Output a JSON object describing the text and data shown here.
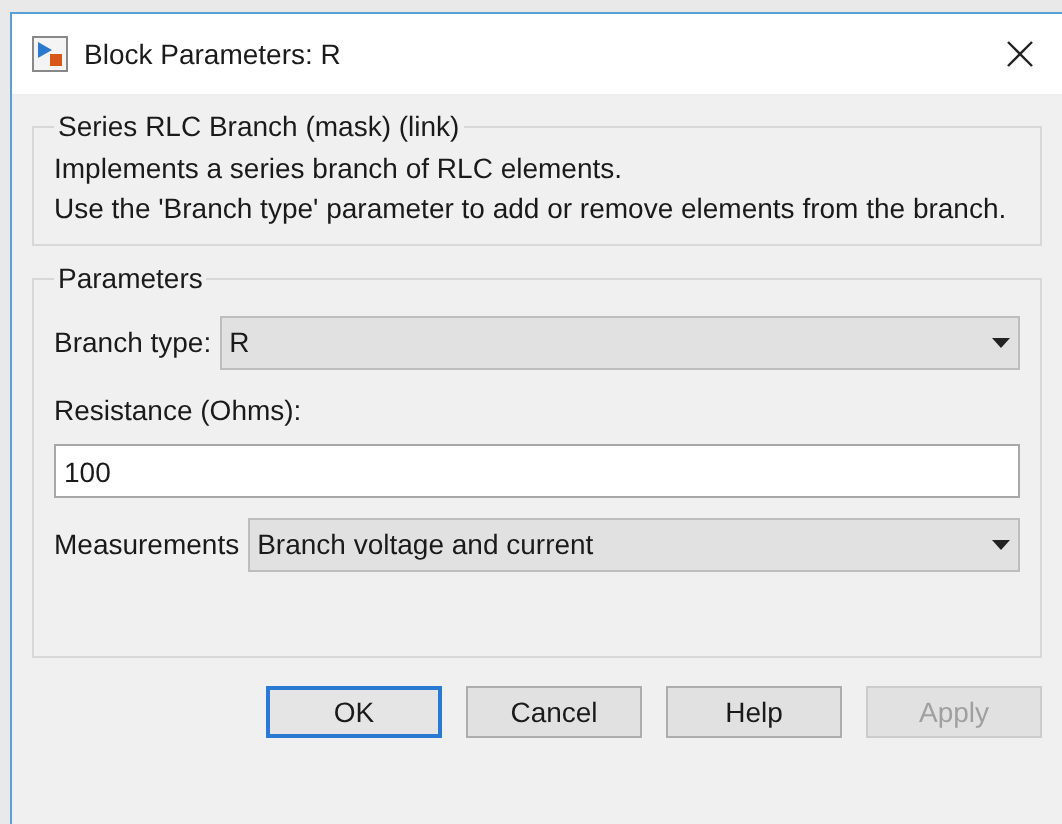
{
  "window": {
    "title": "Block Parameters: R"
  },
  "description_group": {
    "title": "Series RLC Branch (mask) (link)",
    "lines": [
      "Implements a series branch of RLC elements.",
      "Use the 'Branch type' parameter to add or remove elements from the branch."
    ]
  },
  "parameters_group": {
    "title": "Parameters",
    "fields": [
      {
        "kind": "dropdown",
        "label": "Branch type:",
        "value": "R"
      },
      {
        "kind": "text",
        "label": "Resistance (Ohms):",
        "value": "100"
      },
      {
        "kind": "dropdown",
        "label": "Measurements",
        "value": "Branch voltage and current"
      }
    ]
  },
  "buttons": [
    {
      "label": "OK",
      "focused": true,
      "disabled": false
    },
    {
      "label": "Cancel",
      "focused": false,
      "disabled": false
    },
    {
      "label": "Help",
      "focused": false,
      "disabled": false
    },
    {
      "label": "Apply",
      "focused": false,
      "disabled": true
    }
  ]
}
